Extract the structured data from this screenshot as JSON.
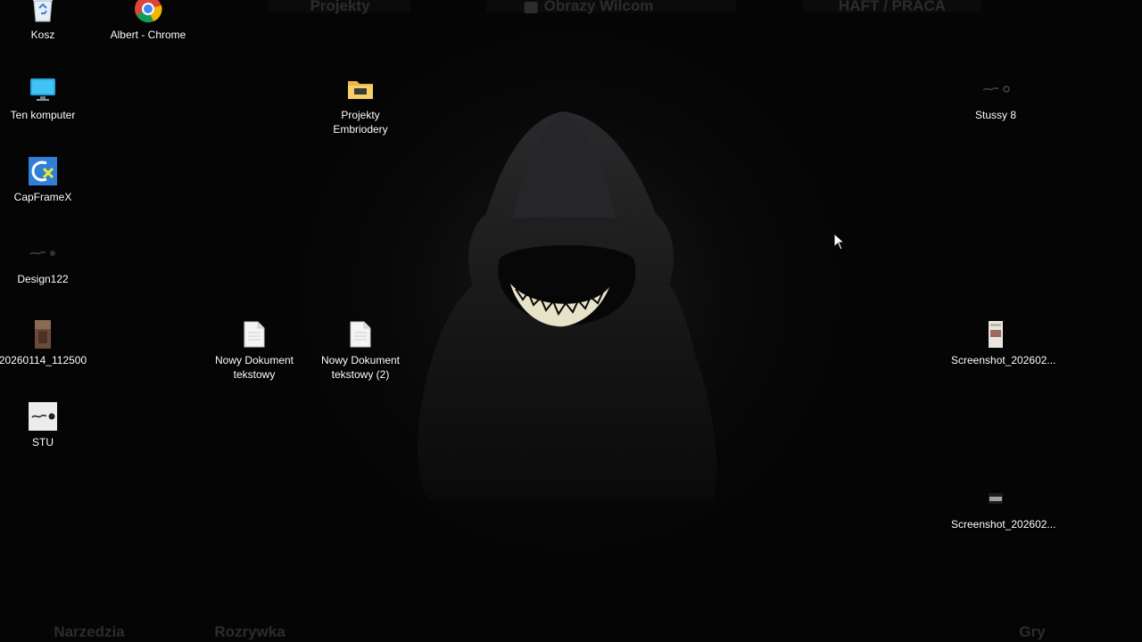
{
  "wallpaper": {
    "description_icon": "hooded-figure-grin-wallpaper"
  },
  "fences": {
    "top": [
      "Projekty",
      "Obrazy Wilcom",
      "HAFT / PRACA"
    ],
    "bottom": [
      "Narzedzia",
      "Rozrywka",
      "Gry"
    ]
  },
  "icons": {
    "kosz": {
      "label": "Kosz",
      "icon": "recycle-bin-icon"
    },
    "chrome": {
      "label": "Albert - Chrome",
      "icon": "chrome-icon"
    },
    "computer": {
      "label": "Ten komputer",
      "icon": "monitor-icon"
    },
    "embroidery": {
      "label": "Projekty Embriodery",
      "icon": "folder-icon"
    },
    "stussy8": {
      "label": "Stussy 8",
      "icon": "image-thumbnail-icon"
    },
    "capframex": {
      "label": "CapFrameX",
      "icon": "capframex-icon"
    },
    "design122": {
      "label": "Design122",
      "icon": "image-thumbnail-icon"
    },
    "photo": {
      "label": "20260114_112500",
      "icon": "photo-thumbnail-icon"
    },
    "doc1": {
      "label_line1": "Nowy Dokument",
      "label_line2": "tekstowy",
      "icon": "text-document-icon"
    },
    "doc2": {
      "label_line1": "Nowy Dokument",
      "label_line2": "tekstowy (2)",
      "icon": "text-document-icon"
    },
    "screenshot1": {
      "label": "Screenshot_202602...",
      "icon": "screenshot-thumbnail-icon"
    },
    "stu": {
      "label": "STU",
      "icon": "image-thumbnail-icon"
    },
    "screenshot2": {
      "label": "Screenshot_202602...",
      "icon": "screenshot-thumbnail-icon"
    }
  },
  "colors": {
    "background": "#050506",
    "fence_text": "#2c2c2e",
    "label_text": "#ffffff",
    "grin": "#e8e2c8"
  }
}
